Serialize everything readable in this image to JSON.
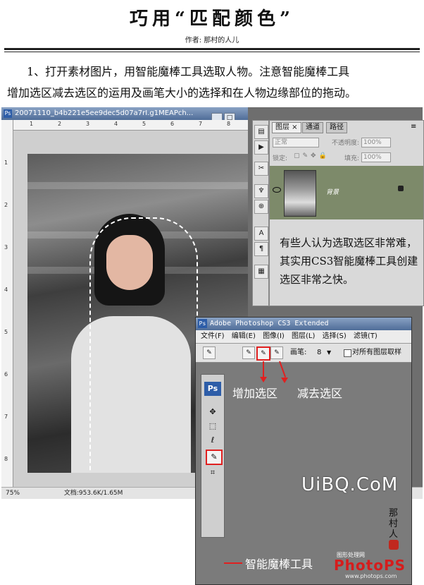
{
  "header": {
    "title": "巧用“匹配颜色”",
    "author": "作者: 那村的人儿"
  },
  "intro": {
    "line1": "1、打开素材图片，用智能魔棒工具选取人物。注意智能魔棒工具",
    "line2": "增加选区减去选区的运用及画笔大小的选择和在人物边缘部位的拖动。"
  },
  "document": {
    "title": "20071110_b4b221e5ee9dec5d07a7rI.g1MEAPch...",
    "zoom": "75%",
    "doc_size": "文档:953.6K/1.65M",
    "ruler_top_ticks": [
      "1",
      "2",
      "3",
      "4",
      "5",
      "6",
      "7",
      "8"
    ],
    "ruler_left_ticks": [
      "1",
      "2",
      "3",
      "4",
      "5",
      "6",
      "7",
      "8"
    ]
  },
  "layers_panel": {
    "tabs": [
      "图层 ×",
      "通道",
      "路径"
    ],
    "blend_mode": "正常",
    "opacity_label": "不透明度:",
    "opacity_value": "100%",
    "lock_label": "锁定:",
    "fill_label": "填充:",
    "fill_value": "100%",
    "layer_name": "背景"
  },
  "note": {
    "text": "有些人认为选取选区非常难，其实用CS3智能魔棒工具创建选区非常之快。"
  },
  "inset": {
    "title": "Adobe Photoshop CS3 Extended",
    "ps_badge": "Ps",
    "menu": [
      "文件(F)",
      "编辑(E)",
      "图像(I)",
      "图层(L)",
      "选择(S)",
      "滤镜(T)"
    ],
    "brush_label": "画笔:",
    "brush_size": "8",
    "sample_all": "对所有图层取样",
    "label_add": "增加选区",
    "label_subtract": "减去选区",
    "label_tool": "智能魔棒工具",
    "brand_small": "图形处理网",
    "brand": "PhotoPS",
    "brand_url": "www.photops.com"
  },
  "watermark": {
    "text": "UiBQ.CoM"
  },
  "colors": {
    "accent_red": "#e02020",
    "layer_row": "#7d8a6a",
    "titlebar": "#4f6d98"
  }
}
